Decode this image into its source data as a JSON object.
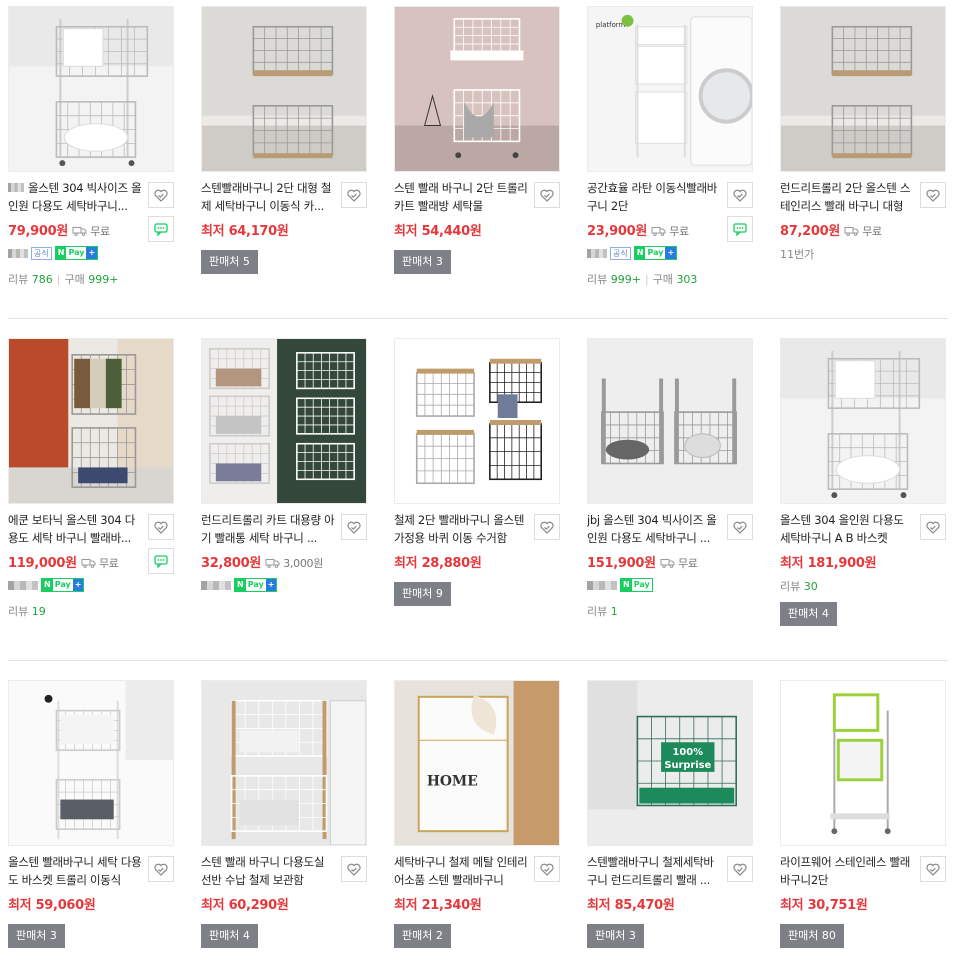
{
  "rows": [
    {
      "items": [
        {
          "title": "올스텐 304 빅사이즈 올인원 다용도 세탁바구니...",
          "has_seller_icon": true,
          "price": "79,900원",
          "ship": "무료",
          "badges": {
            "gong": "공식",
            "npay": true
          },
          "review_label": "리뷰",
          "review": "786",
          "buy_label": "구매",
          "buy": "999+",
          "talk": true,
          "image": "cart2white"
        },
        {
          "title": "스텐빨래바구니 2단 대형 철제 세탁바구니 이동식 카...",
          "prefix": "최저",
          "price": "64,170원",
          "seller": "판매처 5",
          "image": "cart2wood"
        },
        {
          "title": "스텐 빨래 바구니 2단 트롤리 카트 빨래방 세탁물",
          "prefix": "최저",
          "price": "54,440원",
          "seller": "판매처 3",
          "image": "cart2pink"
        },
        {
          "title": "공간효율 라탄 이동식빨래바구니 2단",
          "price": "23,900원",
          "ship": "무료",
          "badges": {
            "gong": "공식",
            "npay": true
          },
          "review_label": "리뷰",
          "review": "999+",
          "buy_label": "구매",
          "buy": "303",
          "talk": true,
          "image": "washer",
          "brand": "platform"
        },
        {
          "title": "런드리트롤리 2단 올스텐 스테인리스 빨래 바구니 대형",
          "price": "87,200원",
          "ship": "무료",
          "note": "11번가",
          "image": "cart2wood"
        }
      ]
    },
    {
      "items": [
        {
          "title": "에쿤 보타닉 올스텐 304 다용도 세탁 바구니 빨래바...",
          "price": "119,000원",
          "ship": "무료",
          "badges": {
            "npay": true
          },
          "review_label": "리뷰",
          "review": "19",
          "talk": true,
          "image": "orange"
        },
        {
          "title": "런드리트롤리 카트 대용량 아기 빨래통 세탁 바구니 ...",
          "price": "32,800원",
          "ship": "3,000원",
          "badges": {
            "npay": true
          },
          "image": "cart3"
        },
        {
          "title": "철제 2단 빨래바구니 올스텐 가정용 바퀴 이동 수거함",
          "prefix": "최저",
          "price": "28,880원",
          "seller": "판매처 9",
          "image": "pair"
        },
        {
          "title": "jbj 올스텐 304 빅사이즈 올인원 다용도 세탁바구니 ...",
          "price": "151,900원",
          "ship": "무료",
          "badges": {
            "npay_plain": true
          },
          "review_label": "리뷰",
          "review": "1",
          "image": "twobaskets"
        },
        {
          "title": "올스텐 304 올인원 다용도 세탁바구니 A B 바스켓",
          "prefix": "최저",
          "price": "181,900원",
          "review_label": "리뷰",
          "review": "30",
          "seller": "판매처 4",
          "image": "cart2white"
        }
      ]
    },
    {
      "items": [
        {
          "title": "올스텐 빨래바구니 세탁 다용도 바스켓 트롤리 이동식",
          "prefix": "최저",
          "price": "59,060원",
          "seller": "판매처 3",
          "image": "tallwhite"
        },
        {
          "title": "스텐 빨래 바구니 다용도실 선반 수납 철제 보관함",
          "prefix": "최저",
          "price": "60,290원",
          "seller": "판매처 4",
          "image": "shelf"
        },
        {
          "title": "세탁바구니 철제 메탈 인테리어소품 스텐 빨래바구니",
          "prefix": "최저",
          "price": "21,340원",
          "seller": "판매처 2",
          "image": "home",
          "home_text": "HOME"
        },
        {
          "title": "스텐빨래바구니 철제세탁바구니 런드리트롤리 빨래 ...",
          "prefix": "최저",
          "price": "85,470원",
          "seller": "판매처 3",
          "image": "green",
          "promo_line1": "100%",
          "promo_line2": "Surprise"
        },
        {
          "title": "라이프웨어 스테인레스 빨래바구니2단",
          "prefix": "최저",
          "price": "30,751원",
          "seller": "판매처 80",
          "image": "lime"
        }
      ]
    }
  ]
}
